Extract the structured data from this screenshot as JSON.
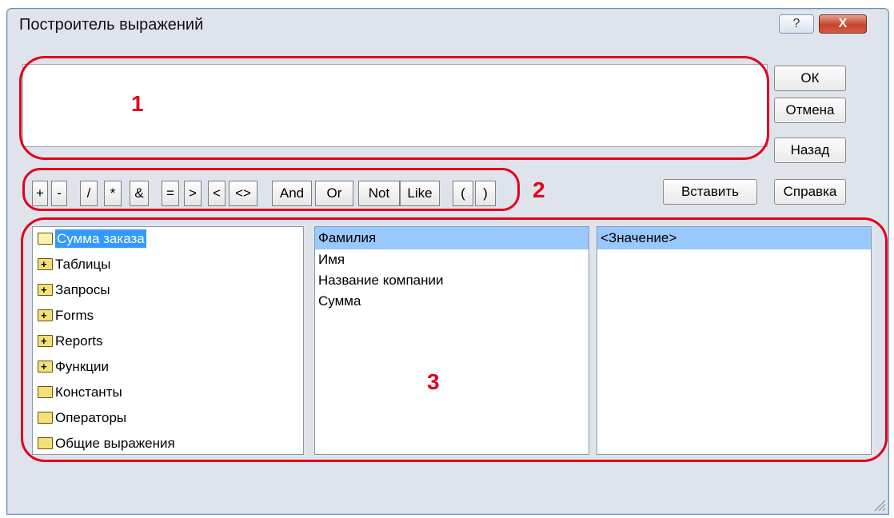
{
  "window": {
    "title": "Построитель выражений"
  },
  "titlebar": {
    "help_label": "?",
    "close_label": "X"
  },
  "expression": {
    "value": ""
  },
  "side_buttons": [
    {
      "label": "ОК"
    },
    {
      "label": "Отмена"
    },
    {
      "label": "Назад"
    }
  ],
  "insert_label": "Вставить",
  "help_button_label": "Справка",
  "operators": [
    "+",
    "-",
    "/",
    "*",
    "&",
    "=",
    ">",
    "<",
    "<>",
    "And",
    "Or",
    "Not",
    "Like",
    "(",
    ")"
  ],
  "tree": [
    {
      "label": "Сумма заказа",
      "icon": "folder-open-icon",
      "selected": true
    },
    {
      "label": "Таблицы",
      "icon": "folder-plus-icon"
    },
    {
      "label": "Запросы",
      "icon": "folder-plus-icon"
    },
    {
      "label": "Forms",
      "icon": "folder-plus-icon"
    },
    {
      "label": "Reports",
      "icon": "folder-plus-icon"
    },
    {
      "label": "Функции",
      "icon": "folder-plus-icon"
    },
    {
      "label": "Константы",
      "icon": "folder-icon"
    },
    {
      "label": "Операторы",
      "icon": "folder-icon"
    },
    {
      "label": "Общие выражения",
      "icon": "folder-icon"
    }
  ],
  "fields": [
    "Фамилия",
    "Имя",
    "Название компании",
    "Сумма"
  ],
  "values": [
    "<Значение>"
  ],
  "annotations": [
    "1",
    "2",
    "3"
  ],
  "colors": {
    "annotation": "#e3001b",
    "selection": "#3399ff"
  }
}
